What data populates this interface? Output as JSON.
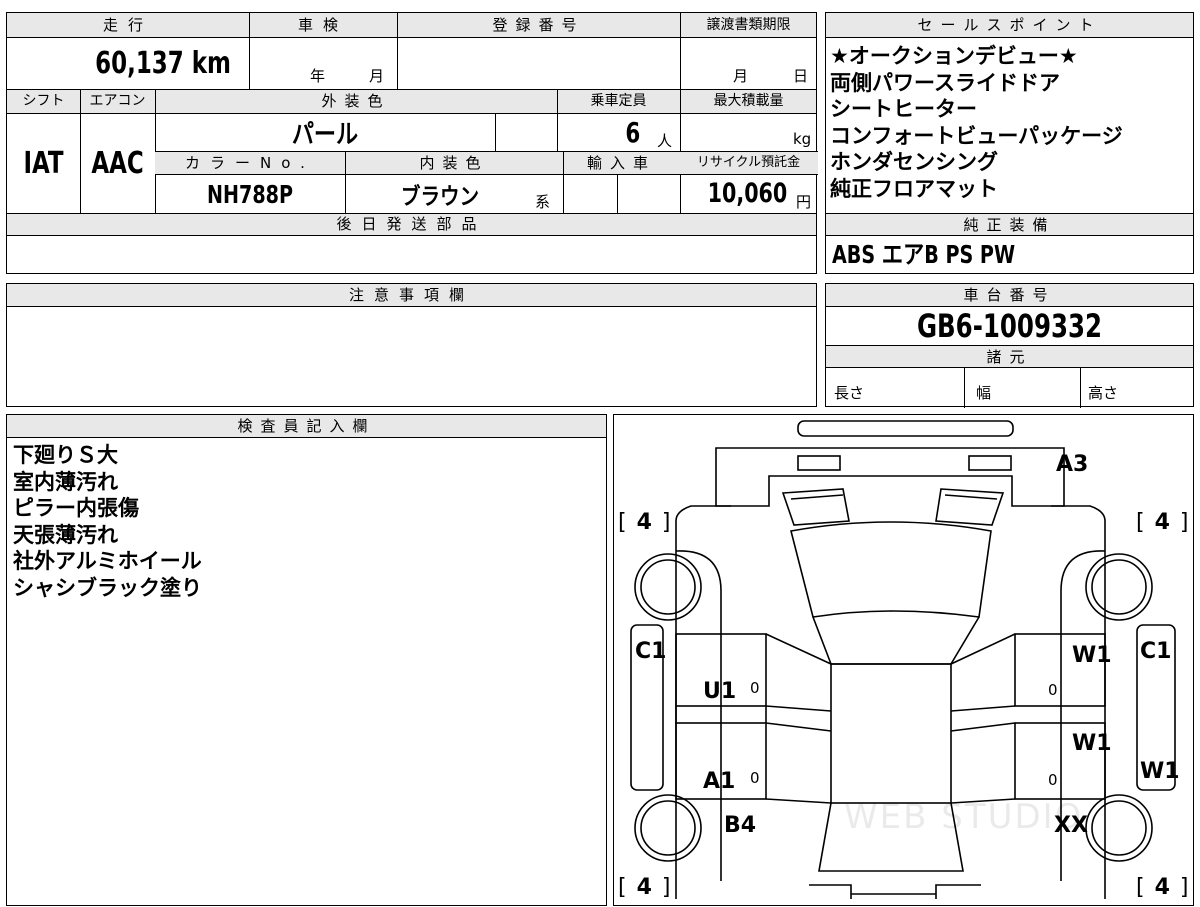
{
  "header_top": {
    "mileage_label": "走行",
    "shaken_label": "車検",
    "registration_label": "登録番号",
    "transfer_deadline_label": "譲渡書類期限",
    "sales_points_label": "セールスポイント"
  },
  "vehicle": {
    "mileage": "60,137 km",
    "shaken_year_unit": "年",
    "shaken_month_unit": "月",
    "deadline_month_unit": "月",
    "deadline_day_unit": "日",
    "shift_label": "シフト",
    "aircon_label": "エアコン",
    "exterior_color_label": "外装色",
    "capacity_label": "乗車定員",
    "max_load_label": "最大積載量",
    "shift": "IAT",
    "aircon": "AAC",
    "exterior_color": "パール",
    "capacity": "6",
    "capacity_unit": "人",
    "load_unit": "kg",
    "color_no_label": "カラーNo.",
    "interior_color_label": "内装色",
    "import_label": "輸入車",
    "recycle_label": "リサイクル預託金",
    "color_no": "NH788P",
    "interior_color": "ブラウン",
    "interior_suffix": "系",
    "recycle_fee": "10,060",
    "recycle_unit": "円",
    "later_parts_label": "後日発送部品"
  },
  "sales_points": [
    "★オークションデビュー★",
    "両側パワースライドドア",
    "シートヒーター",
    "コンフォートビューパッケージ",
    "ホンダセンシング",
    "純正フロアマット"
  ],
  "standard_equipment": {
    "label": "純正装備",
    "value": "ABS エアB PS PW"
  },
  "notes": {
    "label": "注意事項欄"
  },
  "chassis": {
    "label": "車台番号",
    "number": "GB6-1009332",
    "specs_label": "諸元",
    "length_label": "長さ",
    "width_label": "幅",
    "height_label": "高さ"
  },
  "inspector": {
    "label": "検査員記入欄",
    "lines": [
      "下廻りＳ大",
      "室内薄汚れ",
      "ピラー内張傷",
      "天張薄汚れ",
      "社外アルミホイール",
      "シャシブラック塗り"
    ]
  },
  "diagram": {
    "tire_fl": "4",
    "tire_fr": "4",
    "tire_rl": "4",
    "tire_rr": "4",
    "a3": "A3",
    "c1_left": "C1",
    "c1_right": "C1",
    "u1": "U1",
    "a1": "A1",
    "b4": "B4",
    "w1_front": "W1",
    "w1_mid": "W1",
    "w1_side": "W1",
    "xx": "XX",
    "zero": "0",
    "watermark": "WEB STUDIO"
  }
}
